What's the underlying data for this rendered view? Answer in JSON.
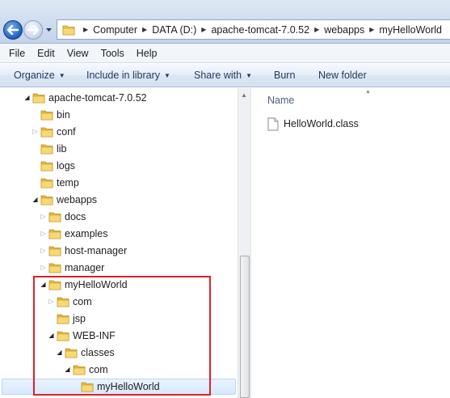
{
  "breadcrumb": [
    "Computer",
    "DATA (D:)",
    "apache-tomcat-7.0.52",
    "webapps",
    "myHelloWorld"
  ],
  "menu": [
    "File",
    "Edit",
    "View",
    "Tools",
    "Help"
  ],
  "toolbar": {
    "organize": "Organize",
    "include_in_library": "Include in library",
    "share_with": "Share with",
    "burn": "Burn",
    "new_folder": "New folder"
  },
  "tree": [
    {
      "label": "apache-tomcat-7.0.52",
      "depth": 0,
      "expander": "open"
    },
    {
      "label": "bin",
      "depth": 1,
      "expander": "none"
    },
    {
      "label": "conf",
      "depth": 1,
      "expander": "closed"
    },
    {
      "label": "lib",
      "depth": 1,
      "expander": "none"
    },
    {
      "label": "logs",
      "depth": 1,
      "expander": "none"
    },
    {
      "label": "temp",
      "depth": 1,
      "expander": "none"
    },
    {
      "label": "webapps",
      "depth": 1,
      "expander": "open"
    },
    {
      "label": "docs",
      "depth": 2,
      "expander": "closed"
    },
    {
      "label": "examples",
      "depth": 2,
      "expander": "closed"
    },
    {
      "label": "host-manager",
      "depth": 2,
      "expander": "closed"
    },
    {
      "label": "manager",
      "depth": 2,
      "expander": "closed"
    },
    {
      "label": "myHelloWorld",
      "depth": 2,
      "expander": "open"
    },
    {
      "label": "com",
      "depth": 3,
      "expander": "closed"
    },
    {
      "label": "jsp",
      "depth": 3,
      "expander": "none"
    },
    {
      "label": "WEB-INF",
      "depth": 3,
      "expander": "open"
    },
    {
      "label": "classes",
      "depth": 4,
      "expander": "open"
    },
    {
      "label": "com",
      "depth": 5,
      "expander": "open"
    },
    {
      "label": "myHelloWorld",
      "depth": 6,
      "expander": "none",
      "selected": true
    }
  ],
  "file_list": {
    "column_header": "Name",
    "files": [
      "HelloWorld.class"
    ]
  },
  "colors": {
    "highlight_box": "#e0202a",
    "folder": "#f2c54b",
    "selection": "#d8e9fc"
  }
}
